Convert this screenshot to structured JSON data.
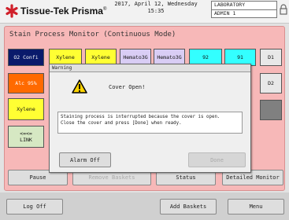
{
  "header": {
    "brand": "Tissue-Tek Prisma",
    "brand_mark": "®",
    "date": "2017, April 12, Wednesday",
    "time": "15:35",
    "account_line1": "LABORATORY",
    "account_line2": "ADMIN 1"
  },
  "panel": {
    "title": "Stain Process Monitor (Continuous Mode)",
    "row1": [
      "O2 Confi",
      "Xylene",
      "Xylene",
      "Hemato3G",
      "Hemato3G",
      "92",
      "91",
      "D1"
    ],
    "left_column": [
      "Alc 95%",
      "Xylene",
      "<=<=\nLINK"
    ],
    "right_column": [
      "D2"
    ],
    "bottom_buttons": [
      "Pause",
      "Remove Baskets",
      "Status",
      "Detailed Monitor"
    ]
  },
  "dialog": {
    "title": "Warning",
    "heading": "Cover Open!",
    "message": "Staining process is interrupted because the cover is open.\nClose the cover and press [Done] when ready.",
    "alarm_off": "Alarm Off",
    "done": "Done"
  },
  "footer": {
    "log_off": "Log Off",
    "add_baskets": "Add Baskets",
    "menu": "Menu"
  },
  "colors": {
    "navy": "#0a1a6b",
    "yellow": "#ffff33",
    "lavender": "#d9cdf5",
    "cyan": "#33ffff",
    "orange": "#ff6a00",
    "link_green": "#d6e8c3",
    "dark_slot": "#808080",
    "panel": "#f7b8b8"
  }
}
